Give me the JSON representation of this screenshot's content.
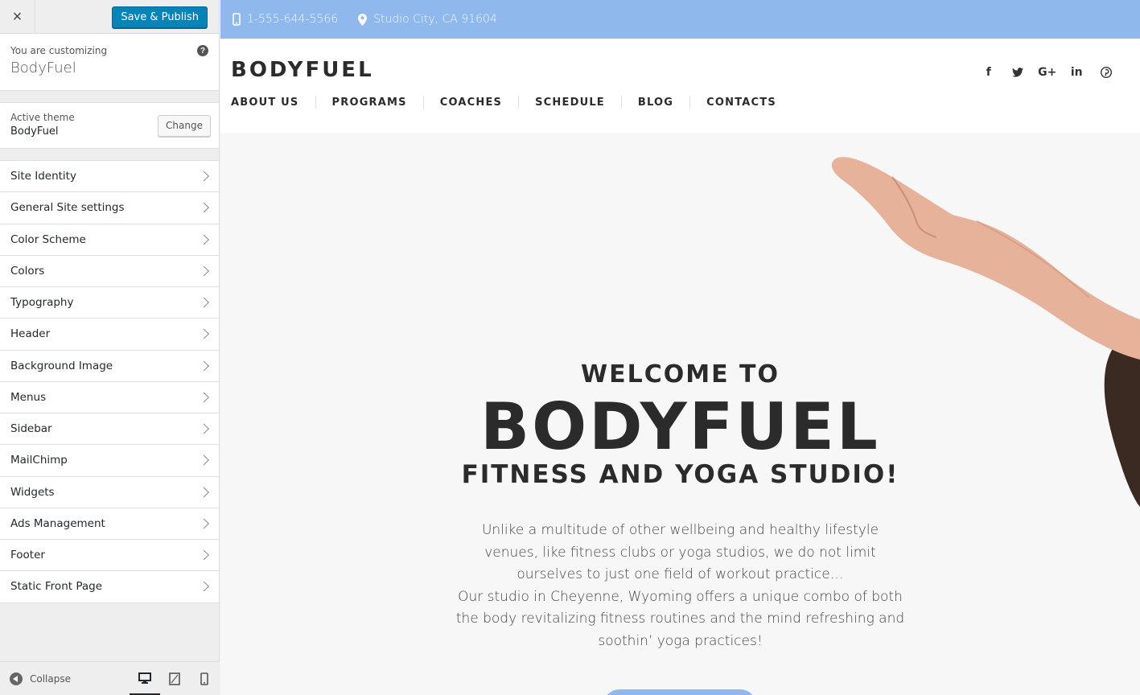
{
  "customizer": {
    "close_label": "×",
    "save_label": "Save & Publish",
    "customizing_label": "You are customizing",
    "site_name": "BodyFuel",
    "help_label": "?",
    "active_theme_label": "Active theme",
    "active_theme_name": "BodyFuel",
    "change_label": "Change",
    "sections": [
      {
        "label": "Site Identity"
      },
      {
        "label": "General Site settings"
      },
      {
        "label": "Color Scheme"
      },
      {
        "label": "Colors"
      },
      {
        "label": "Typography"
      },
      {
        "label": "Header"
      },
      {
        "label": "Background Image"
      },
      {
        "label": "Menus"
      },
      {
        "label": "Sidebar"
      },
      {
        "label": "MailChimp"
      },
      {
        "label": "Widgets"
      },
      {
        "label": "Ads Management"
      },
      {
        "label": "Footer"
      },
      {
        "label": "Static Front Page"
      }
    ],
    "collapse_label": "Collapse",
    "devices": [
      "desktop",
      "tablet",
      "mobile"
    ],
    "active_device": "desktop"
  },
  "site": {
    "phone": "1-555-644-5566",
    "address": "Studio City, CA 91604",
    "logo": "BODYFUEL",
    "social": [
      {
        "icon": "facebook-icon",
        "glyph": "f"
      },
      {
        "icon": "twitter-icon",
        "glyph": "t"
      },
      {
        "icon": "google-plus-icon",
        "glyph": "G+"
      },
      {
        "icon": "linkedin-icon",
        "glyph": "in"
      },
      {
        "icon": "pinterest-icon",
        "glyph": "p"
      }
    ],
    "nav": [
      "ABOUT US",
      "PROGRAMS",
      "COACHES",
      "SCHEDULE",
      "BLOG",
      "CONTACTS"
    ],
    "hero": {
      "welcome": "WELCOME TO",
      "brand": "BODYFUEL",
      "tagline": "FITNESS AND YOGA STUDIO!",
      "desc_1": "Unlike a multitude of other wellbeing and healthy lifestyle venues, like fitness clubs or yoga studios, we do not limit ourselves to just one field of workout practice…",
      "desc_2": "Our studio in Cheyenne, Wyoming offers a unique combo of both the body revitalizing fitness routines and the mind refreshing and soothin’ yoga practices!"
    }
  },
  "colors": {
    "accent": "#0085ba",
    "topbar": "#8fb8ec",
    "text_dark": "#2b2b2b"
  }
}
